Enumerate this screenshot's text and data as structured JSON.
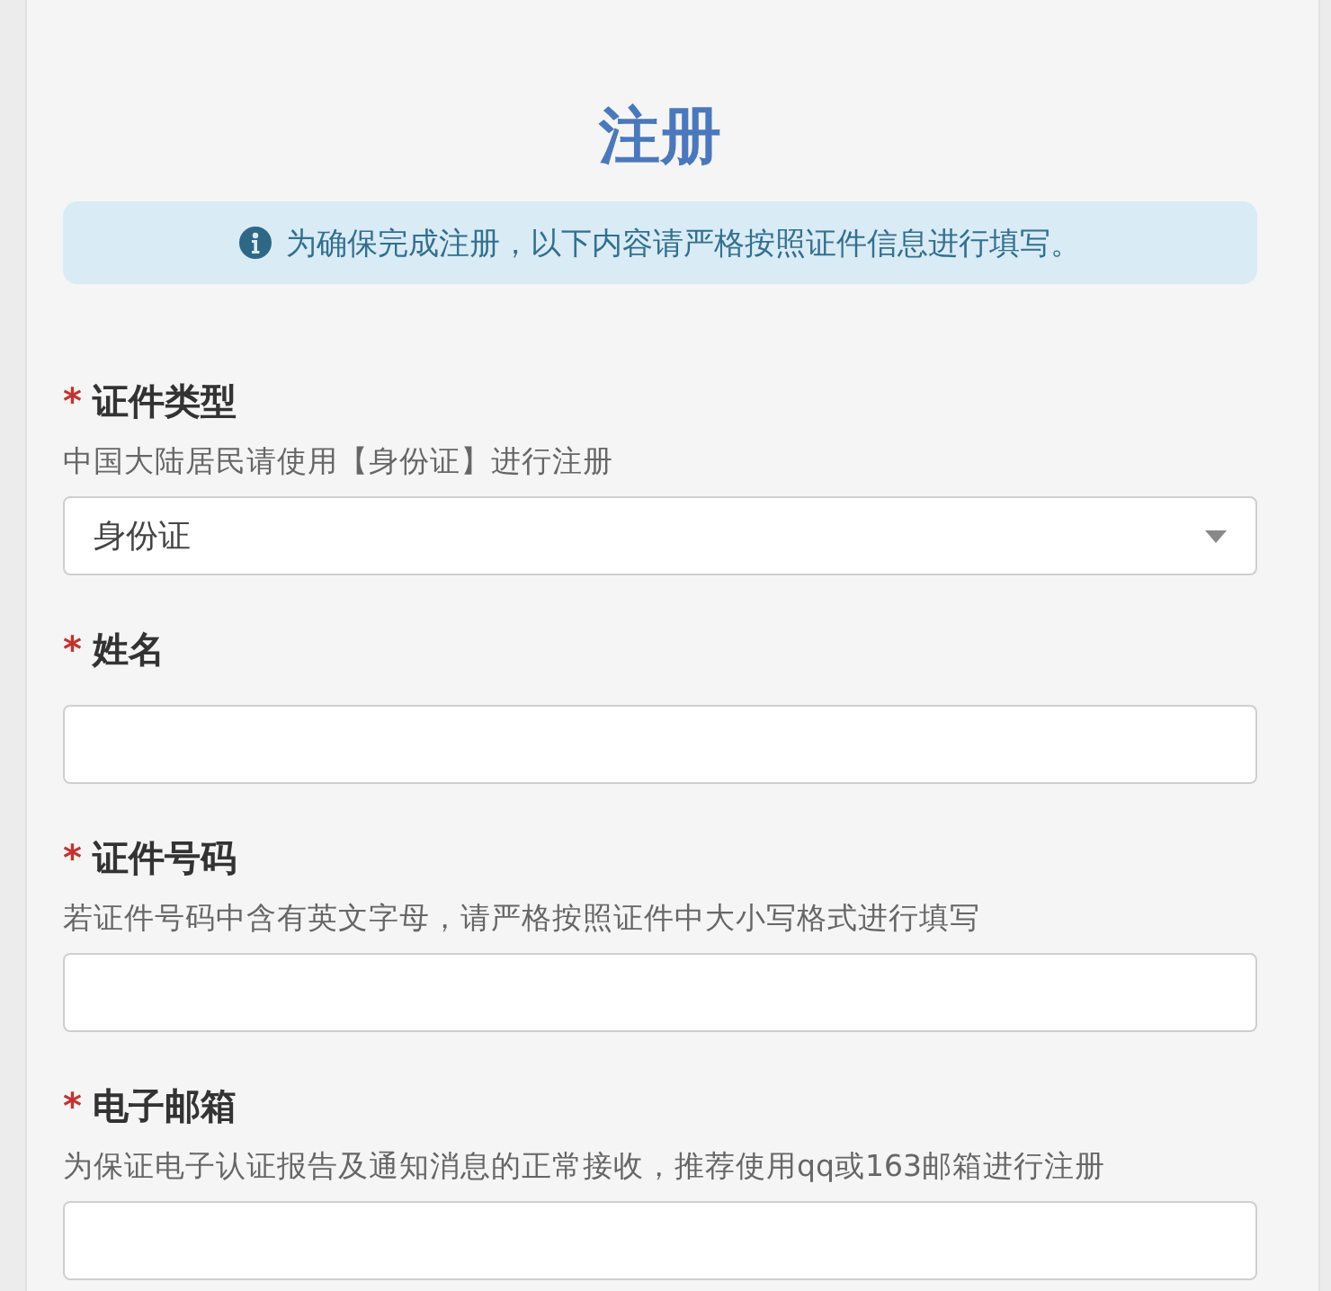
{
  "title": "注册",
  "notice": {
    "text": "为确保完成注册，以下内容请严格按照证件信息进行填写。"
  },
  "fields": [
    {
      "kind": "select",
      "required_mark": "*",
      "label": "证件类型",
      "hint": "中国大陆居民请使用【身份证】进行注册",
      "value": "身份证"
    },
    {
      "kind": "text",
      "required_mark": "*",
      "label": "姓名"
    },
    {
      "kind": "text",
      "required_mark": "*",
      "label": "证件号码",
      "hint": "若证件号码中含有英文字母，请严格按照证件中大小写格式进行填写"
    },
    {
      "kind": "text",
      "required_mark": "*",
      "label": "电子邮箱",
      "hint": "为保证电子认证报告及通知消息的正常接收，推荐使用qq或163邮箱进行注册"
    }
  ]
}
